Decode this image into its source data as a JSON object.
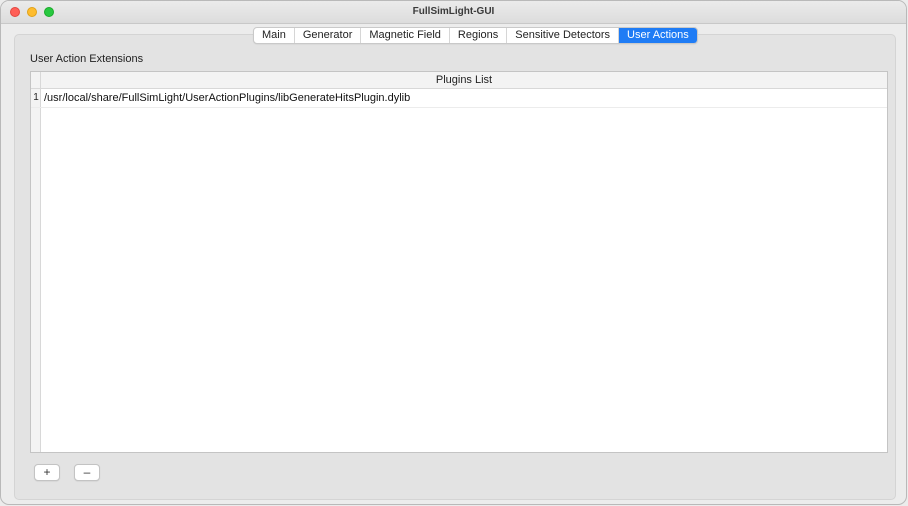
{
  "window": {
    "title": "FullSimLight-GUI"
  },
  "tabs": [
    {
      "label": "Main",
      "active": false
    },
    {
      "label": "Generator",
      "active": false
    },
    {
      "label": "Magnetic Field",
      "active": false
    },
    {
      "label": "Regions",
      "active": false
    },
    {
      "label": "Sensitive Detectors",
      "active": false
    },
    {
      "label": "User Actions",
      "active": true
    }
  ],
  "section": {
    "label": "User Action Extensions"
  },
  "plugins_table": {
    "header": "Plugins List",
    "rows": [
      {
        "num": "1",
        "value": "/usr/local/share/FullSimLight/UserActionPlugins/libGenerateHitsPlugin.dylib"
      }
    ]
  },
  "buttons": {
    "add_label": "+",
    "remove_label": "–"
  },
  "colors": {
    "accent": "#1f7cf5",
    "close": "#ff5f57",
    "minimize": "#febc2e",
    "maximize": "#28c840"
  }
}
